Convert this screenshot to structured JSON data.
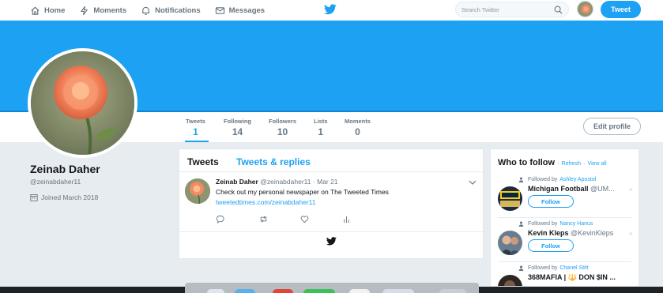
{
  "nav": {
    "home": "Home",
    "moments": "Moments",
    "notifications": "Notifications",
    "messages": "Messages",
    "search_placeholder": "Search Twitter",
    "tweet_button": "Tweet"
  },
  "colors": {
    "brand": "#1da1f2",
    "background": "#e6ecf0",
    "text_secondary": "#657786"
  },
  "profile_nav": {
    "stats": [
      {
        "label": "Tweets",
        "value": "1"
      },
      {
        "label": "Following",
        "value": "14"
      },
      {
        "label": "Followers",
        "value": "10"
      },
      {
        "label": "Lists",
        "value": "1"
      },
      {
        "label": "Moments",
        "value": "0"
      }
    ],
    "edit_profile": "Edit profile"
  },
  "profile": {
    "name": "Zeinab Daher",
    "handle": "@zeinabdaher11",
    "joined": "Joined March 2018"
  },
  "timeline": {
    "tab_tweets": "Tweets",
    "tab_replies": "Tweets & replies",
    "tweet": {
      "name": "Zeinab Daher",
      "handle": "@zeinabdaher11",
      "separator": "·",
      "time": "Mar 21",
      "text": "Check out my personal newspaper on The Tweeted Times",
      "link": "tweetedtimes.com/zeinabdaher11"
    }
  },
  "who_to_follow": {
    "title": "Who to follow",
    "refresh": "Refresh",
    "view_all": "View all",
    "dot": "·",
    "close": "×",
    "followed_by_prefix": "Followed by",
    "follow_label": "Follow",
    "items": [
      {
        "followed_by": "Ashley Apostol",
        "name": "Michigan Football",
        "handle": "@UM..."
      },
      {
        "followed_by": "Nancy Hanus",
        "name": "Kevin Kleps",
        "handle": "@KevinKleps"
      },
      {
        "followed_by": "Chanel Stitt",
        "name": "368MAFIA | 🔱 DON $IN ...",
        "handle": ""
      }
    ]
  },
  "icons": [
    "home-icon",
    "moments-icon",
    "notifications-icon",
    "messages-icon",
    "twitter-bird-icon",
    "search-icon",
    "reply-icon",
    "retweet-icon",
    "like-icon",
    "analytics-icon",
    "calendar-icon",
    "person-icon"
  ]
}
